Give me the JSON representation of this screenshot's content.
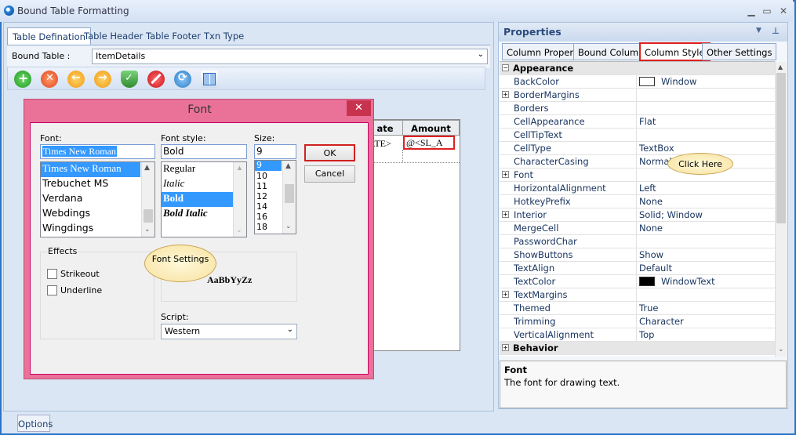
{
  "window": {
    "title": "Bound Table Formatting",
    "buttons": {
      "minimize": "▁",
      "restore": "▭",
      "close": "✕"
    }
  },
  "left": {
    "tabs": [
      "Table Defination",
      "Table Header",
      "Table Footer",
      "Txn Type"
    ],
    "bound_table_label": "Bound Table :",
    "bound_table_value": "ItemDetails",
    "grid": {
      "headers": [
        "ate",
        "Amount"
      ],
      "row1": [
        "ATE>",
        "@<SL_A"
      ]
    }
  },
  "font_dialog": {
    "title": "Font",
    "font_label": "Font:",
    "font_value": "Times New Roman",
    "fonts": [
      "Times New Roman",
      "Trebuchet MS",
      "Verdana",
      "Webdings",
      "Wingdings"
    ],
    "style_label": "Font style:",
    "style_value": "Bold",
    "styles": [
      "Regular",
      "Italic",
      "Bold",
      "Bold Italic"
    ],
    "size_label": "Size:",
    "size_value": "9",
    "sizes": [
      "9",
      "10",
      "11",
      "12",
      "14",
      "16",
      "18"
    ],
    "ok": "OK",
    "cancel": "Cancel",
    "effects_label": "Effects",
    "strikeout": "Strikeout",
    "underline": "Underline",
    "sample_text": "AaBbYyZz",
    "script_label": "Script:",
    "script_value": "Western",
    "callout": "Font Settings"
  },
  "properties": {
    "title": "Properties",
    "tabs": [
      "Column Property",
      "Bound Columns",
      "Column Style",
      "Other Settings"
    ],
    "categories": {
      "appearance": "Appearance",
      "behavior": "Behavior"
    },
    "rows": [
      {
        "name": "BackColor",
        "value": "Window",
        "swatch": "#ffffff"
      },
      {
        "name": "BorderMargins",
        "value": "",
        "expand": true
      },
      {
        "name": "Borders",
        "value": ""
      },
      {
        "name": "CellAppearance",
        "value": "Flat"
      },
      {
        "name": "CellTipText",
        "value": ""
      },
      {
        "name": "CellType",
        "value": "TextBox"
      },
      {
        "name": "CharacterCasing",
        "value": "Normal"
      },
      {
        "name": "Font",
        "value": "",
        "expand": true
      },
      {
        "name": "HorizontalAlignment",
        "value": "Left"
      },
      {
        "name": "HotkeyPrefix",
        "value": "None"
      },
      {
        "name": "Interior",
        "value": "Solid; Window",
        "expand": true
      },
      {
        "name": "MergeCell",
        "value": "None"
      },
      {
        "name": "PasswordChar",
        "value": ""
      },
      {
        "name": "ShowButtons",
        "value": "Show"
      },
      {
        "name": "TextAlign",
        "value": "Default"
      },
      {
        "name": "TextColor",
        "value": "WindowText",
        "swatch": "#000000"
      },
      {
        "name": "TextMargins",
        "value": "",
        "expand": true
      },
      {
        "name": "Themed",
        "value": "True"
      },
      {
        "name": "Trimming",
        "value": "Character"
      },
      {
        "name": "VerticalAlignment",
        "value": "Top"
      }
    ],
    "callout": "Click Here",
    "desc_title": "Font",
    "desc_text": "The font for drawing text."
  },
  "options_button": "Options"
}
